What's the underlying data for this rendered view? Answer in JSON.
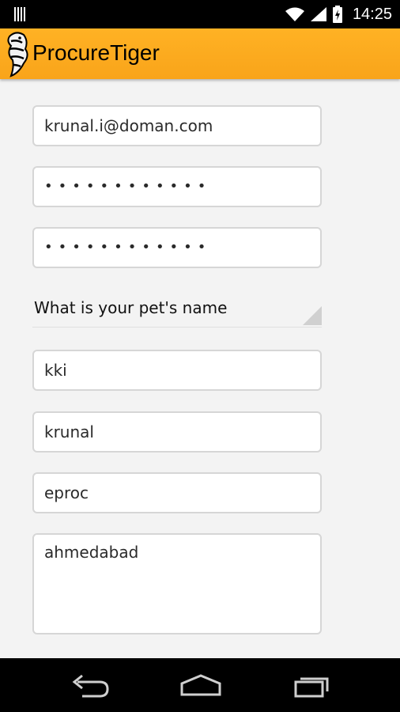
{
  "status_bar": {
    "time": "14:25",
    "icons": [
      "notification-bars-icon",
      "wifi-icon",
      "signal-icon",
      "battery-charging-icon"
    ]
  },
  "app": {
    "title": "ProcureTiger",
    "logo_icon": "tiger-logo-icon",
    "accent_color": "#f9a41a"
  },
  "form": {
    "email": "krunal.i@doman.com",
    "password": "••••••••••••",
    "confirm_password": "••••••••••••",
    "security_question": "What is your pet's name",
    "security_answer": "kki",
    "name": "krunal",
    "company": "eproc",
    "address": "ahmedabad"
  },
  "nav_bar": {
    "icons": [
      "back-icon",
      "home-icon",
      "recent-apps-icon"
    ]
  }
}
